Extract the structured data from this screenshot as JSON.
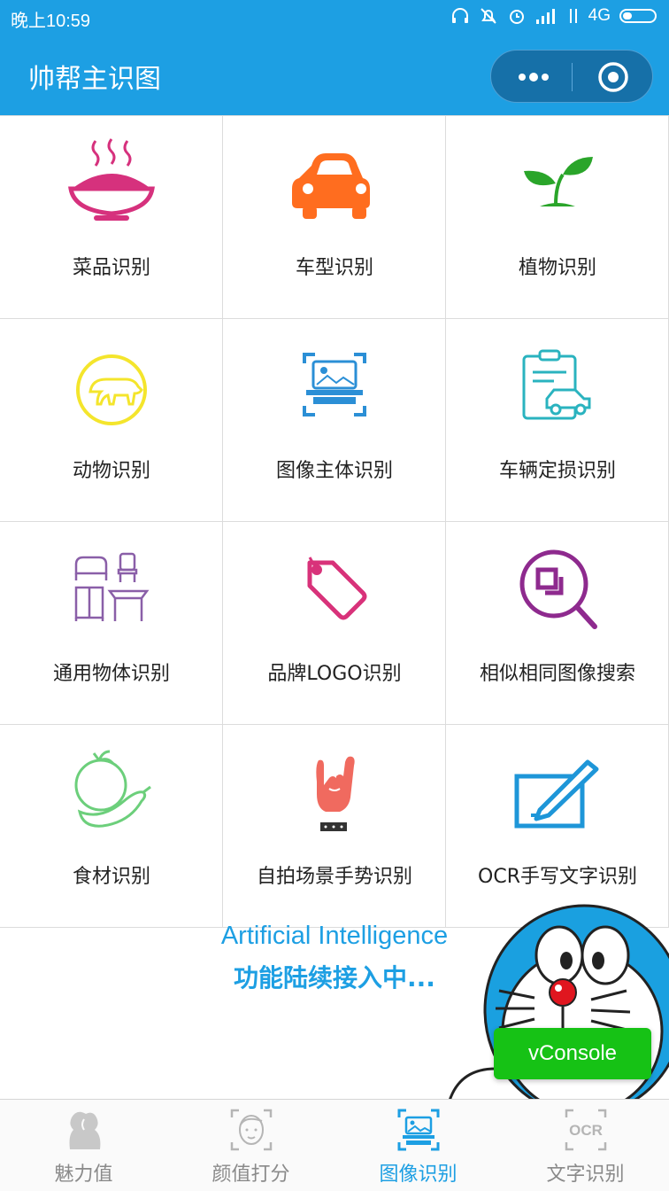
{
  "status_bar": {
    "time": "晚上10:59",
    "network": "4G"
  },
  "header": {
    "title": "帅帮主识图"
  },
  "grid": [
    {
      "label": "菜品识别",
      "icon": "dish-icon"
    },
    {
      "label": "车型识别",
      "icon": "car-icon"
    },
    {
      "label": "植物识别",
      "icon": "plant-icon"
    },
    {
      "label": "动物识别",
      "icon": "animal-icon"
    },
    {
      "label": "图像主体识别",
      "icon": "image-subject-icon"
    },
    {
      "label": "车辆定损识别",
      "icon": "vehicle-damage-icon"
    },
    {
      "label": "通用物体识别",
      "icon": "furniture-icon"
    },
    {
      "label": "品牌LOGO识别",
      "icon": "tag-icon"
    },
    {
      "label": "相似相同图像搜索",
      "icon": "image-search-icon"
    },
    {
      "label": "食材识别",
      "icon": "vegetable-icon"
    },
    {
      "label": "自拍场景手势识别",
      "icon": "hand-gesture-icon"
    },
    {
      "label": "OCR手写文字识别",
      "icon": "handwriting-icon"
    }
  ],
  "banner": {
    "english": "Artificial Intelligence",
    "chinese": "功能陆续接入中..."
  },
  "vconsole": {
    "label": "vConsole"
  },
  "tabs": [
    {
      "label": "魅力值",
      "icon": "couple-icon",
      "active": false
    },
    {
      "label": "颜值打分",
      "icon": "face-scan-icon",
      "active": false
    },
    {
      "label": "图像识别",
      "icon": "image-scan-icon",
      "active": true
    },
    {
      "label": "文字识别",
      "icon": "ocr-icon",
      "active": false
    }
  ],
  "colors": {
    "brand": "#1d9fe3",
    "vconsole": "#16c215"
  }
}
